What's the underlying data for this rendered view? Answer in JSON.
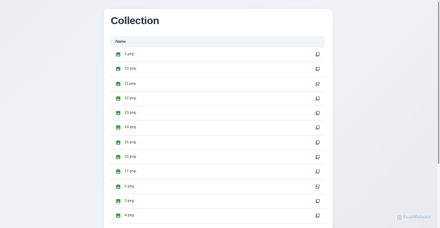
{
  "page": {
    "title": "Collection"
  },
  "table": {
    "header": "Name",
    "rows": [
      {
        "name": "1.png",
        "icon": "image-icon",
        "action_icon": "copy-icon"
      },
      {
        "name": "10.png",
        "icon": "image-icon",
        "action_icon": "copy-icon"
      },
      {
        "name": "11.png",
        "icon": "image-icon",
        "action_icon": "copy-icon"
      },
      {
        "name": "12.png",
        "icon": "image-icon",
        "action_icon": "copy-icon"
      },
      {
        "name": "13.png",
        "icon": "image-icon",
        "action_icon": "copy-icon"
      },
      {
        "name": "14.png",
        "icon": "image-icon",
        "action_icon": "copy-icon"
      },
      {
        "name": "15.png",
        "icon": "image-icon",
        "action_icon": "copy-icon"
      },
      {
        "name": "16.png",
        "icon": "image-icon",
        "action_icon": "copy-icon"
      },
      {
        "name": "17.png",
        "icon": "image-icon",
        "action_icon": "copy-icon"
      },
      {
        "name": "2.png",
        "icon": "image-icon",
        "action_icon": "copy-icon"
      },
      {
        "name": "3.png",
        "icon": "image-icon",
        "action_icon": "copy-icon"
      },
      {
        "name": "4.png",
        "icon": "image-icon",
        "action_icon": "copy-icon"
      }
    ]
  },
  "watermark": {
    "text": "ScanMalware"
  },
  "colors": {
    "icon_green": "#3d9a4a",
    "title": "#1f2937",
    "header_bg": "#f3f4f6",
    "watermark": "#b4c6de"
  }
}
